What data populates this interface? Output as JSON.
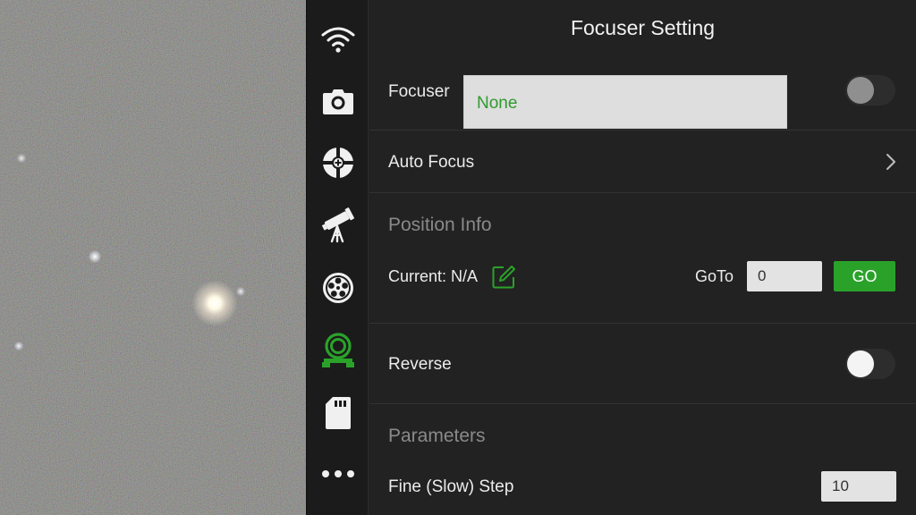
{
  "panel": {
    "title": "Focuser Setting",
    "focuser": {
      "label": "Focuser",
      "selected": "None",
      "enabled": false
    },
    "auto_focus": {
      "label": "Auto Focus"
    },
    "position_info": {
      "section_label": "Position Info",
      "current": "Current: N/A",
      "goto_label": "GoTo",
      "goto_value": "0",
      "go_button": "GO"
    },
    "reverse": {
      "label": "Reverse",
      "enabled": false
    },
    "parameters": {
      "section_label": "Parameters",
      "fine_step_label": "Fine (Slow) Step",
      "fine_step_value": "10"
    }
  },
  "sidebar": {
    "items": [
      {
        "icon": "wifi-icon",
        "active": false
      },
      {
        "icon": "camera-icon",
        "active": false
      },
      {
        "icon": "guide-crosshair-icon",
        "active": false
      },
      {
        "icon": "telescope-icon",
        "active": false
      },
      {
        "icon": "filter-wheel-icon",
        "active": false
      },
      {
        "icon": "focuser-icon",
        "active": true
      },
      {
        "icon": "sd-card-icon",
        "active": false
      },
      {
        "icon": "more-icon",
        "active": false
      }
    ]
  },
  "colors": {
    "accent": "#2aa22a",
    "active_icon": "#2aa22a",
    "icon": "#f0f0f0",
    "background": "#222222",
    "sidebar": "#1b1b1b",
    "section_label": "#8a8a8a"
  }
}
